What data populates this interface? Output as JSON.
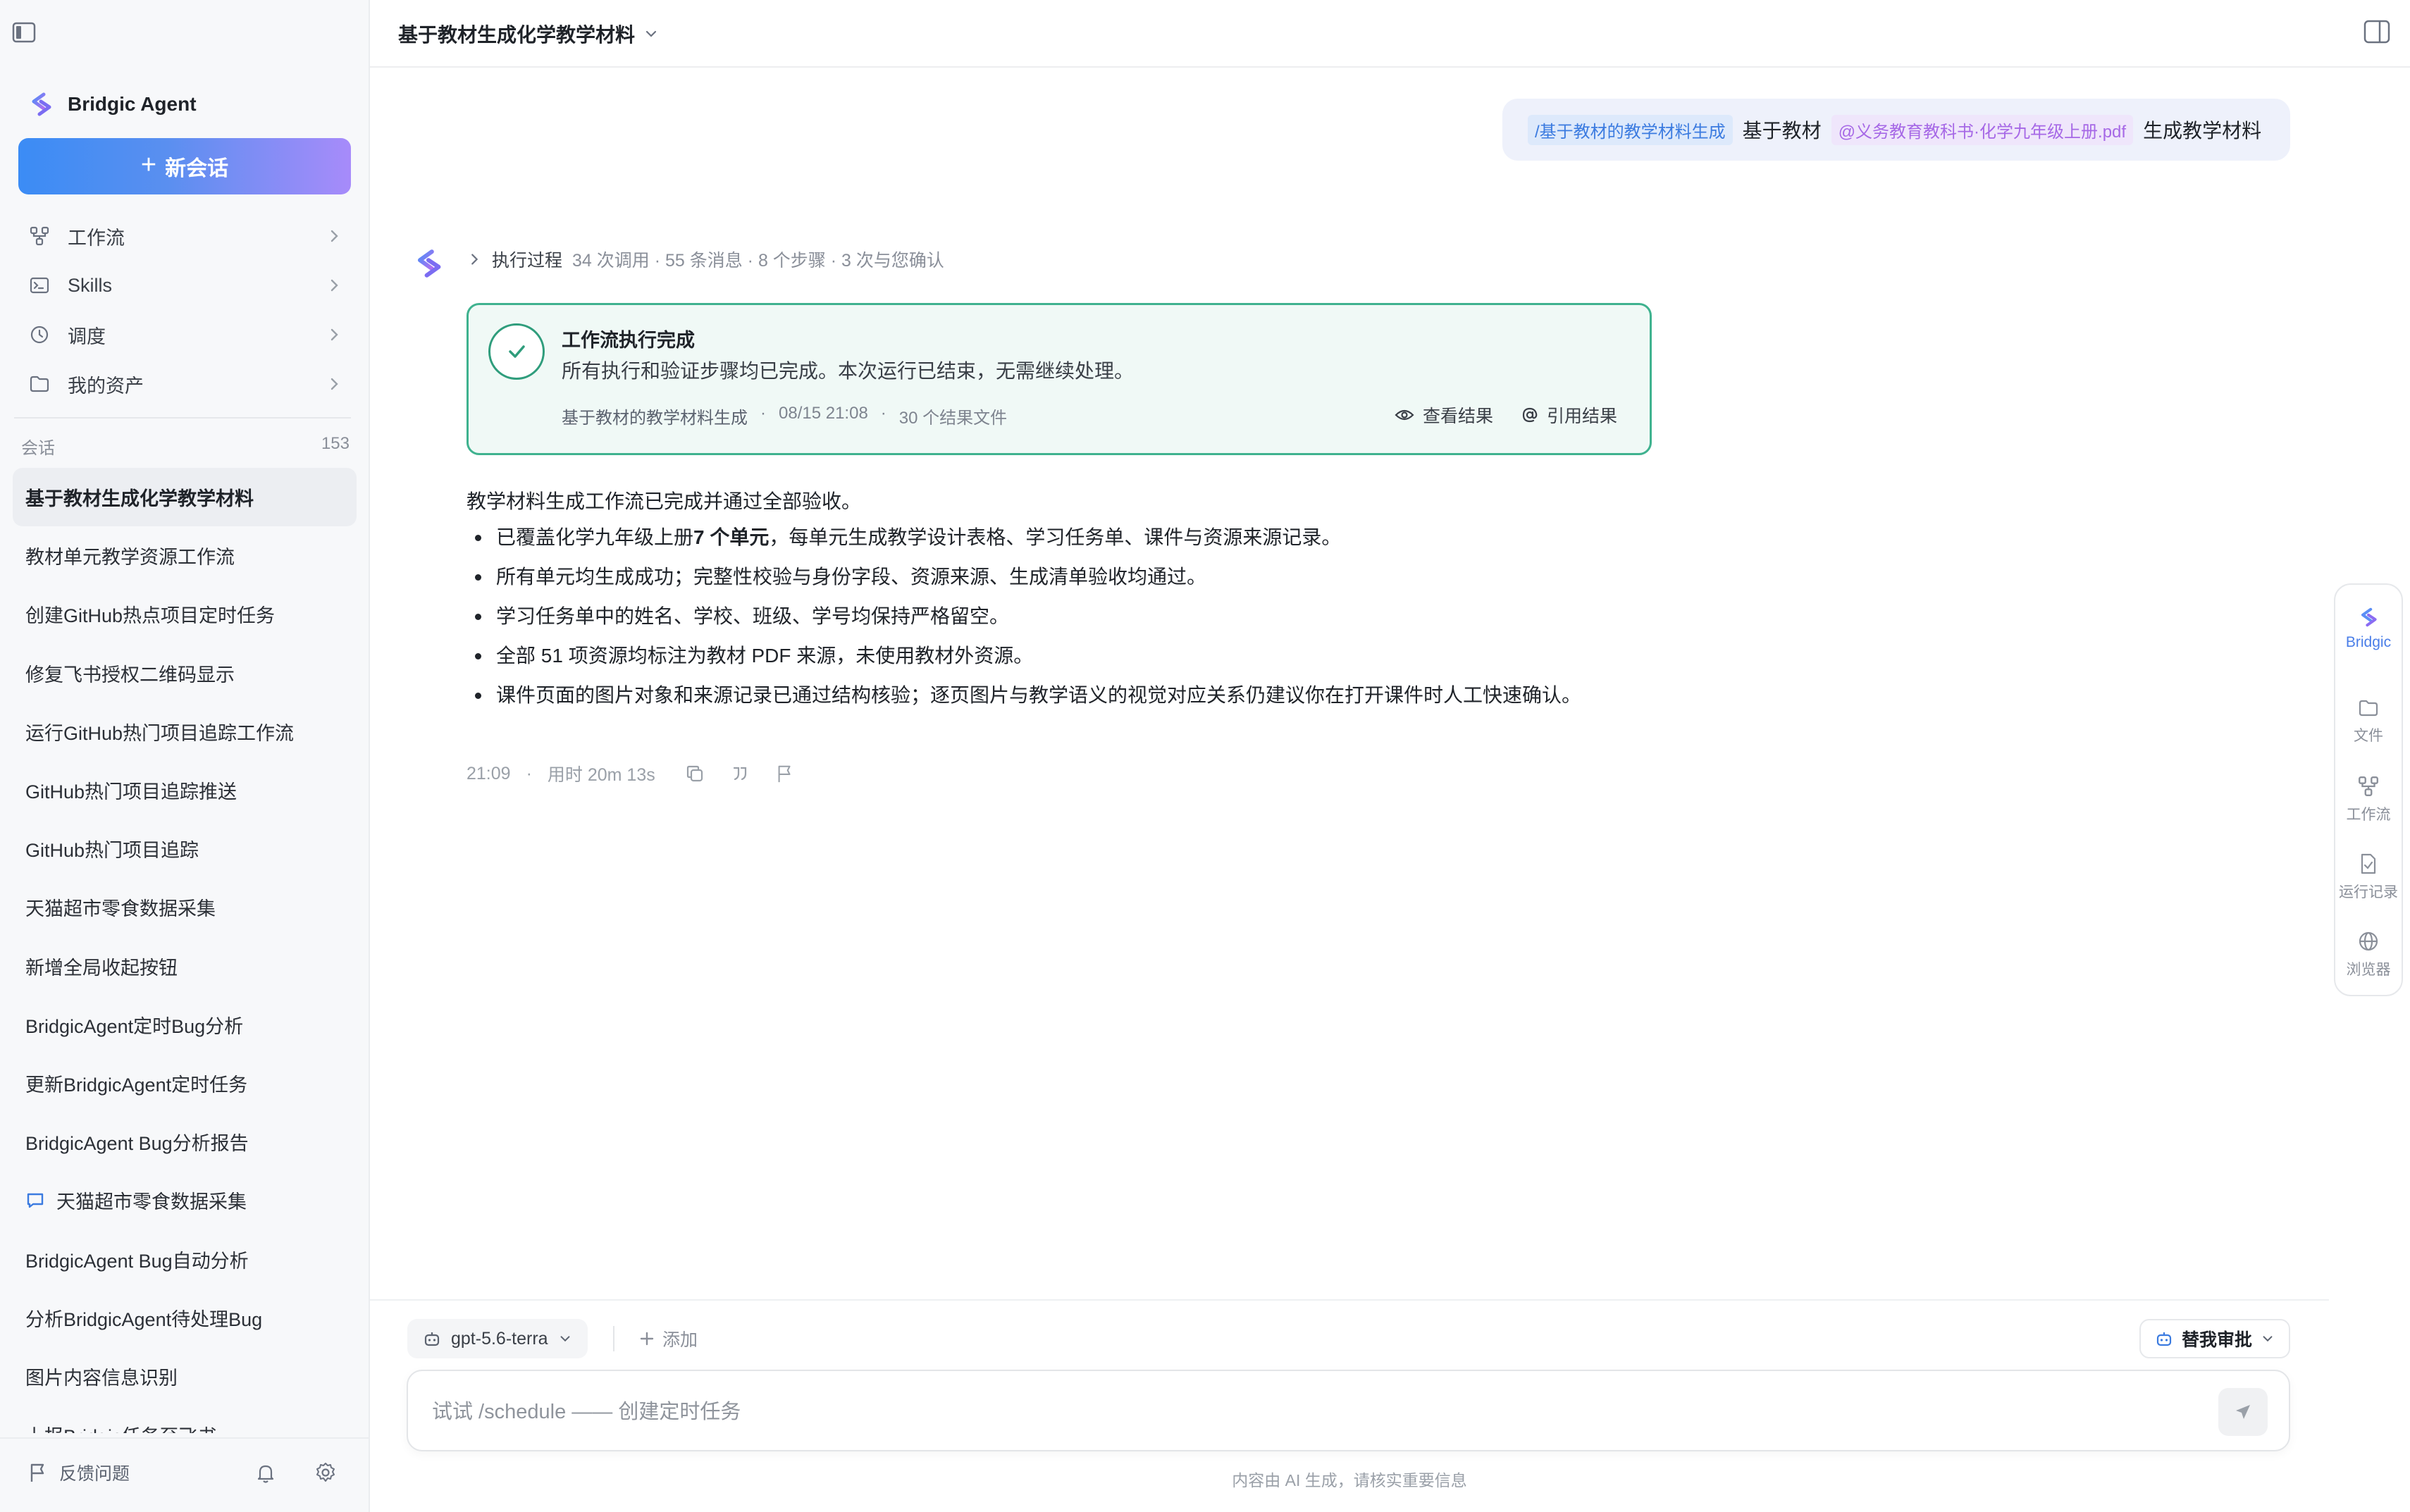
{
  "sidebar": {
    "brand_name": "Bridgic Agent",
    "new_chat_label": "新会话",
    "nav": [
      {
        "label": "工作流",
        "icon": "workflow-icon"
      },
      {
        "label": "Skills",
        "icon": "terminal-icon"
      },
      {
        "label": "调度",
        "icon": "clock-icon"
      },
      {
        "label": "我的资产",
        "icon": "folder-icon"
      }
    ],
    "sessions_label": "会话",
    "sessions_count": "153",
    "sessions": [
      {
        "title": "基于教材生成化学教学材料"
      },
      {
        "title": "教材单元教学资源工作流"
      },
      {
        "title": "创建GitHub热点项目定时任务"
      },
      {
        "title": "修复飞书授权二维码显示"
      },
      {
        "title": "运行GitHub热门项目追踪工作流"
      },
      {
        "title": "GitHub热门项目追踪推送"
      },
      {
        "title": "GitHub热门项目追踪"
      },
      {
        "title": "天猫超市零食数据采集"
      },
      {
        "title": "新增全局收起按钮"
      },
      {
        "title": "BridgicAgent定时Bug分析"
      },
      {
        "title": "更新BridgicAgent定时任务"
      },
      {
        "title": "BridgicAgent Bug分析报告"
      },
      {
        "title": "天猫超市零食数据采集"
      },
      {
        "title": "BridgicAgent Bug自动分析"
      },
      {
        "title": "分析BridgicAgent待处理Bug"
      },
      {
        "title": "图片内容信息识别"
      },
      {
        "title": "上报Bridgic任务至飞书"
      }
    ],
    "footer": {
      "feedback_label": "反馈问题"
    }
  },
  "topbar": {
    "title": "基于教材生成化学教学材料"
  },
  "user_message": {
    "command_chip": "/基于教材的教学材料生成",
    "text_a": "基于教材",
    "file_chip": "@义务教育教科书·化学九年级上册.pdf",
    "text_b": "生成教学材料"
  },
  "agent": {
    "exec_label": "执行过程",
    "exec_meta": "34 次调用 · 55 条消息 · 8 个步骤 · 3 次与您确认",
    "card": {
      "title": "工作流执行完成",
      "desc": "所有执行和验证步骤均已完成。本次运行已结束，无需继续处理。",
      "workflow": "基于教材的教学材料生成",
      "time": "08/15 21:08",
      "files": "30 个结果文件",
      "view_label": "查看结果",
      "cite_label": "引用结果"
    },
    "intro": "教学材料生成工作流已完成并通过全部验收。",
    "bullet1_pre": "已覆盖化学九年级上册",
    "bullet1_bold": "7 个单元",
    "bullet1_post": "，每单元生成教学设计表格、学习任务单、课件与资源来源记录。",
    "bullet2": "所有单元均生成成功；完整性校验与身份字段、资源来源、生成清单验收均通过。",
    "bullet3": "学习任务单中的姓名、学校、班级、学号均保持严格留空。",
    "bullet4": "全部 51 项资源均标注为教材 PDF 来源，未使用教材外资源。",
    "bullet5": "课件页面的图片对象和来源记录已通过结构核验；逐页图片与教学语义的视觉对应关系仍建议你在打开课件时人工快速确认。",
    "time": "21:09",
    "duration": "用时 20m 13s"
  },
  "rail": {
    "bridgic": "Bridgic",
    "files": "文件",
    "workflow": "工作流",
    "runs": "运行记录",
    "browser": "浏览器"
  },
  "composer": {
    "model": "gpt-5.6-terra",
    "add_label": "添加",
    "approve_label": "替我审批",
    "placeholder": "试试 /schedule —— 创建定时任务",
    "disclaimer": "内容由 AI 生成，请核实重要信息"
  },
  "colors": {
    "accent": "#4a7ee8",
    "success_border": "#3fb28f",
    "success_bg": "#f0f9f6",
    "command_chip": "#3b7be0",
    "file_chip": "#a668e6"
  }
}
